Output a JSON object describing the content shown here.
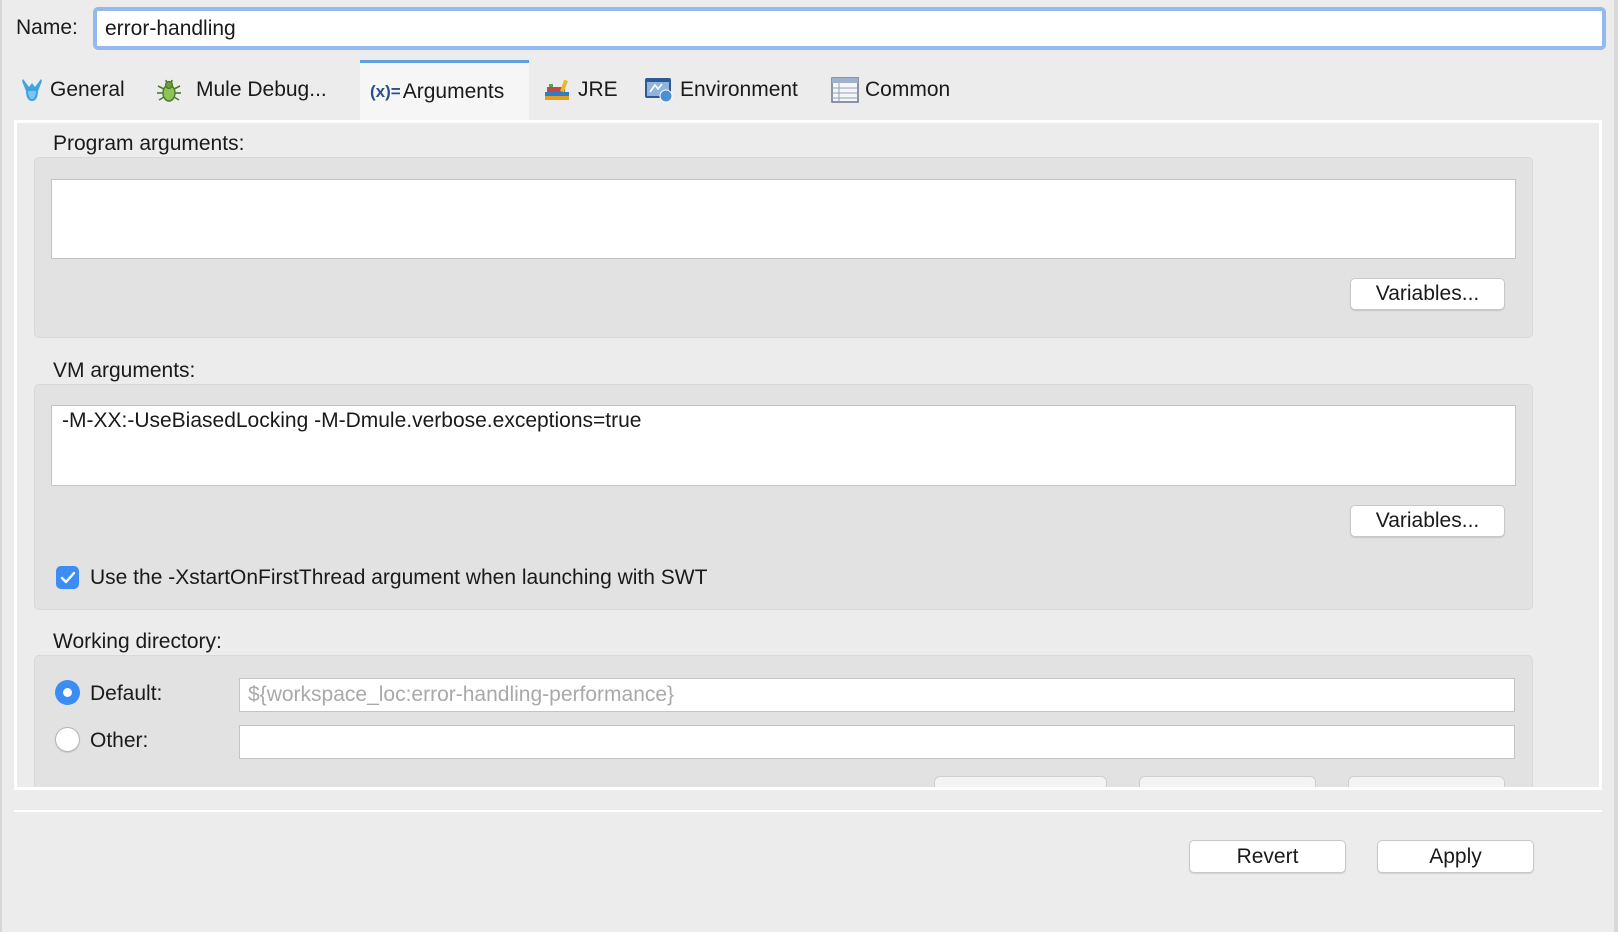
{
  "name": {
    "label": "Name:",
    "value": "error-handling"
  },
  "tabs": [
    {
      "label": "General",
      "icon": "mule-icon"
    },
    {
      "label": "Mule Debug...",
      "icon": "bug-icon"
    },
    {
      "label": "Arguments",
      "icon": "variable-x-icon",
      "icon_text": "(x)="
    },
    {
      "label": "JRE",
      "icon": "books-icon"
    },
    {
      "label": "Environment",
      "icon": "environment-icon"
    },
    {
      "label": "Common",
      "icon": "table-icon"
    }
  ],
  "active_tab": "Arguments",
  "program_arguments": {
    "label": "Program arguments:",
    "value": "",
    "variables_label": "Variables..."
  },
  "vm_arguments": {
    "label": "VM arguments:",
    "value": "-M-XX:-UseBiasedLocking -M-Dmule.verbose.exceptions=true",
    "variables_label": "Variables...",
    "swt_checkbox": {
      "label": "Use the -XstartOnFirstThread argument when launching with SWT",
      "checked": true
    }
  },
  "working_directory": {
    "label": "Working directory:",
    "default_label": "Default:",
    "default_value": "${workspace_loc:error-handling-performance}",
    "other_label": "Other:",
    "other_value": "",
    "selected": "Default"
  },
  "footer": {
    "revert_label": "Revert",
    "apply_label": "Apply"
  },
  "colors": {
    "accent": "#3b8df3",
    "focus_ring": "#94b9ec",
    "active_tab_border": "#5ea0e0"
  }
}
